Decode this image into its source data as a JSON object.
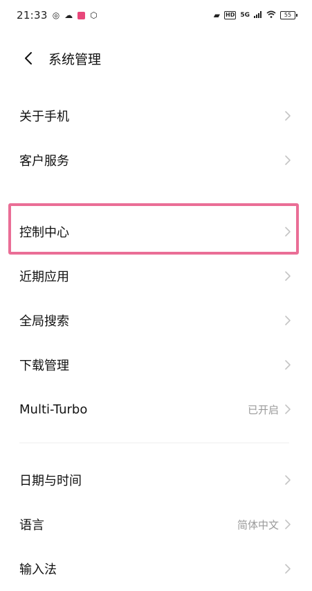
{
  "status_bar": {
    "time": "21:33",
    "signal_text": "5G",
    "battery_text": "55",
    "hd_text": "HD"
  },
  "header": {
    "title": "系统管理"
  },
  "group1": [
    {
      "label": "关于手机",
      "value": ""
    },
    {
      "label": "客户服务",
      "value": ""
    }
  ],
  "group2": [
    {
      "label": "控制中心",
      "value": ""
    },
    {
      "label": "近期应用",
      "value": ""
    },
    {
      "label": "全局搜索",
      "value": ""
    },
    {
      "label": "下载管理",
      "value": ""
    },
    {
      "label": "Multi-Turbo",
      "value": "已开启"
    }
  ],
  "group3": [
    {
      "label": "日期与时间",
      "value": ""
    },
    {
      "label": "语言",
      "value": "简体中文"
    },
    {
      "label": "输入法",
      "value": ""
    }
  ],
  "colors": {
    "highlight": "#ea6e96",
    "muted_text": "#9a9a9a"
  }
}
